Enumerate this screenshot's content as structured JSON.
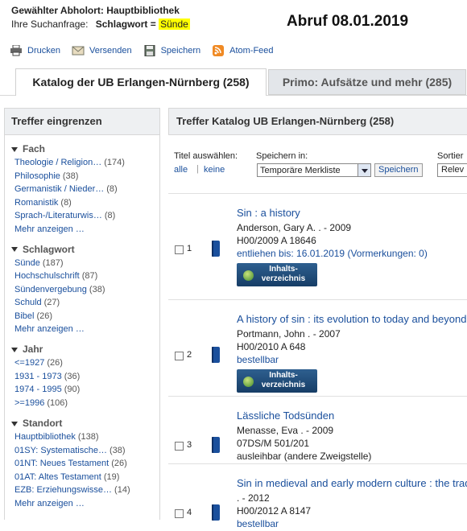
{
  "header": {
    "location_label": "Gewählter Abholort: Hauptbibliothek",
    "query_label": "Ihre Suchanfrage:",
    "query_field": "Schlagwort =",
    "query_value": "Sünde",
    "stamp": "Abruf 08.01.2019"
  },
  "actions": [
    {
      "label": "Drucken",
      "icon": "printer-icon"
    },
    {
      "label": "Versenden",
      "icon": "envelope-icon"
    },
    {
      "label": "Speichern",
      "icon": "floppy-disk-icon"
    },
    {
      "label": "Atom-Feed",
      "icon": "rss-feed-icon"
    }
  ],
  "tabs": [
    {
      "label": "Katalog der UB Erlangen-Nürnberg (258)",
      "active": true
    },
    {
      "label": "Primo: Aufsätze und mehr (285)",
      "active": false
    }
  ],
  "sidebar": {
    "title": "Treffer eingrenzen",
    "facets": [
      {
        "title": "Fach",
        "items": [
          {
            "label": "Theologie / Religion…",
            "count": "(174)"
          },
          {
            "label": "Philosophie",
            "count": "(38)"
          },
          {
            "label": "Germanistik / Nieder…",
            "count": "(8)"
          },
          {
            "label": "Romanistik",
            "count": "(8)"
          },
          {
            "label": "Sprach-/Literaturwis…",
            "count": "(8)"
          }
        ],
        "more": "Mehr anzeigen …"
      },
      {
        "title": "Schlagwort",
        "items": [
          {
            "label": "Sünde",
            "count": "(187)"
          },
          {
            "label": "Hochschulschrift",
            "count": "(87)"
          },
          {
            "label": "Sündenvergebung",
            "count": "(38)"
          },
          {
            "label": "Schuld",
            "count": "(27)"
          },
          {
            "label": "Bibel",
            "count": "(26)"
          }
        ],
        "more": "Mehr anzeigen …"
      },
      {
        "title": "Jahr",
        "items": [
          {
            "label": "<=1927",
            "count": "(26)"
          },
          {
            "label": "1931 - 1973",
            "count": "(36)"
          },
          {
            "label": "1974 - 1995",
            "count": "(90)"
          },
          {
            "label": ">=1996",
            "count": "(106)"
          }
        ],
        "more": ""
      },
      {
        "title": "Standort",
        "items": [
          {
            "label": "Hauptbibliothek",
            "count": "(138)"
          },
          {
            "label": "01SY: Systematische…",
            "count": "(38)"
          },
          {
            "label": "01NT: Neues Testament",
            "count": "(26)"
          },
          {
            "label": "01AT: Altes Testament",
            "count": "(19)"
          },
          {
            "label": "EZB: Erziehungswisse…",
            "count": "(14)"
          }
        ],
        "more": "Mehr anzeigen …"
      }
    ]
  },
  "main": {
    "title": "Treffer Katalog UB Erlangen-Nürnberg (258)",
    "select_titles_label": "Titel auswählen:",
    "select_all": "alle",
    "select_none": "keine",
    "save_in_label": "Speichern in:",
    "save_in_value": "Temporäre Merkliste",
    "save_button": "Speichern",
    "sort_label": "Sortier",
    "sort_value": "Relev",
    "toc_label_1": "Inhalts-",
    "toc_label_2": "verzeichnis",
    "results": [
      {
        "num": "1",
        "title": "Sin : a history",
        "author": "Anderson, Gary A. . - 2009",
        "signature": "H00/2009 A 18646",
        "status": "entliehen bis: 16.01.2019 (Vormerkungen: 0)",
        "status_link": true,
        "toc": true
      },
      {
        "num": "2",
        "title": "A history of sin : its evolution to today and beyond",
        "author": "Portmann, John . - 2007",
        "signature": "H00/2010 A 648",
        "status": "bestellbar",
        "status_link": true,
        "toc": true
      },
      {
        "num": "3",
        "title": "Lässliche Todsünden",
        "author": "Menasse, Eva . - 2009",
        "signature": "07DS/M 501/201",
        "status": "ausleihbar (andere Zweigstelle)",
        "status_link": false,
        "toc": false
      },
      {
        "num": "4",
        "title": "Sin in medieval and early modern culture : the tradition",
        "author": ". - 2012",
        "signature": "H00/2012 A 8147",
        "status": "bestellbar",
        "status_link": true,
        "toc": false
      }
    ]
  }
}
